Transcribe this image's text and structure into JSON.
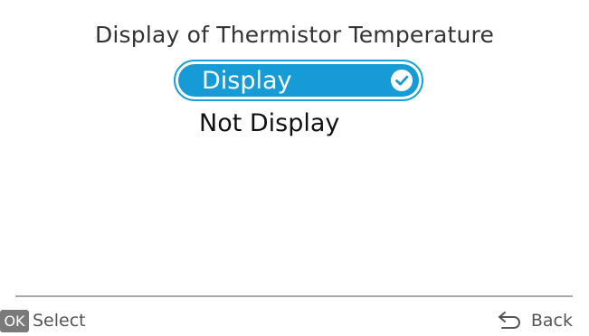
{
  "screen": {
    "title": "Display of Thermistor Temperature"
  },
  "options": [
    {
      "label": "Display",
      "selected": true
    },
    {
      "label": "Not Display",
      "selected": false
    }
  ],
  "footer": {
    "ok_badge": "OK",
    "select_label": "Select",
    "back_label": "Back"
  },
  "icons": {
    "selected_check": "check-circle-icon",
    "back": "back-arrow-icon"
  },
  "colors": {
    "accent": "#179bd7",
    "accent_border": "#1a9fd8",
    "ok_badge_bg": "#7a7a7a",
    "divider": "#a8a8a8"
  }
}
